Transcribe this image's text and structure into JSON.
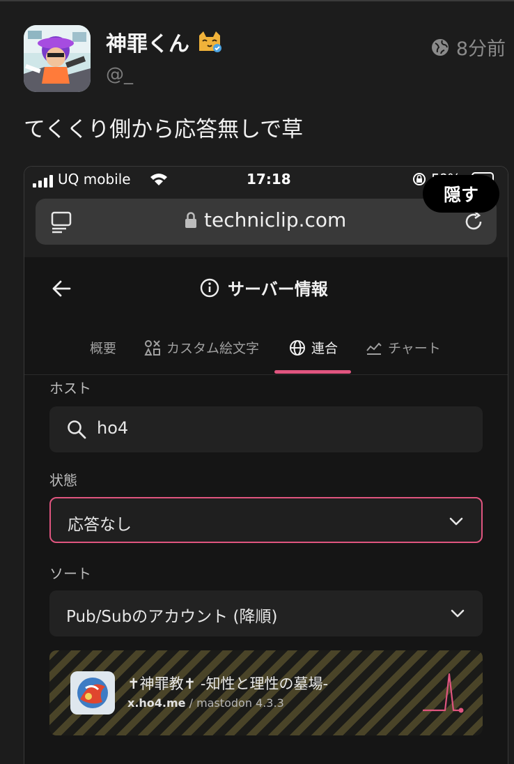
{
  "post": {
    "display_name": "神罪くん",
    "handle": "@_",
    "time": "8分前",
    "text": "てくくり側から応答無しで草"
  },
  "device": {
    "carrier": "UQ mobile",
    "time": "17:18",
    "battery_fragment": "5?%"
  },
  "browser": {
    "url": "techniclip.com",
    "hide_label": "隠す"
  },
  "app": {
    "page_title": "サーバー情報",
    "tabs": [
      {
        "label": "概要"
      },
      {
        "label": "カスタム絵文字"
      },
      {
        "label": "連合"
      },
      {
        "label": "チャート"
      }
    ],
    "active_tab": "連合",
    "host": {
      "label": "ホスト",
      "value": "ho4"
    },
    "state": {
      "label": "状態",
      "value": "応答なし"
    },
    "sort": {
      "label": "ソート",
      "value": "Pub/Subのアカウント (降順)"
    },
    "instance": {
      "name": "✝神罪教✝ -知性と理性の墓場-",
      "host": "x.ho4.me",
      "software": " / mastodon 4.3.3"
    }
  },
  "colors": {
    "accent": "#e0557f",
    "background": "#1c1c1c"
  },
  "icons": [
    "globe-icon",
    "signal-icon",
    "wifi-icon",
    "rotation-lock-icon",
    "battery-icon",
    "reader-icon",
    "lock-icon",
    "reload-icon",
    "back-arrow-icon",
    "info-icon",
    "emoji-shapes-icon",
    "globe-tab-icon",
    "chart-icon",
    "search-icon",
    "chevron-down-icon"
  ]
}
